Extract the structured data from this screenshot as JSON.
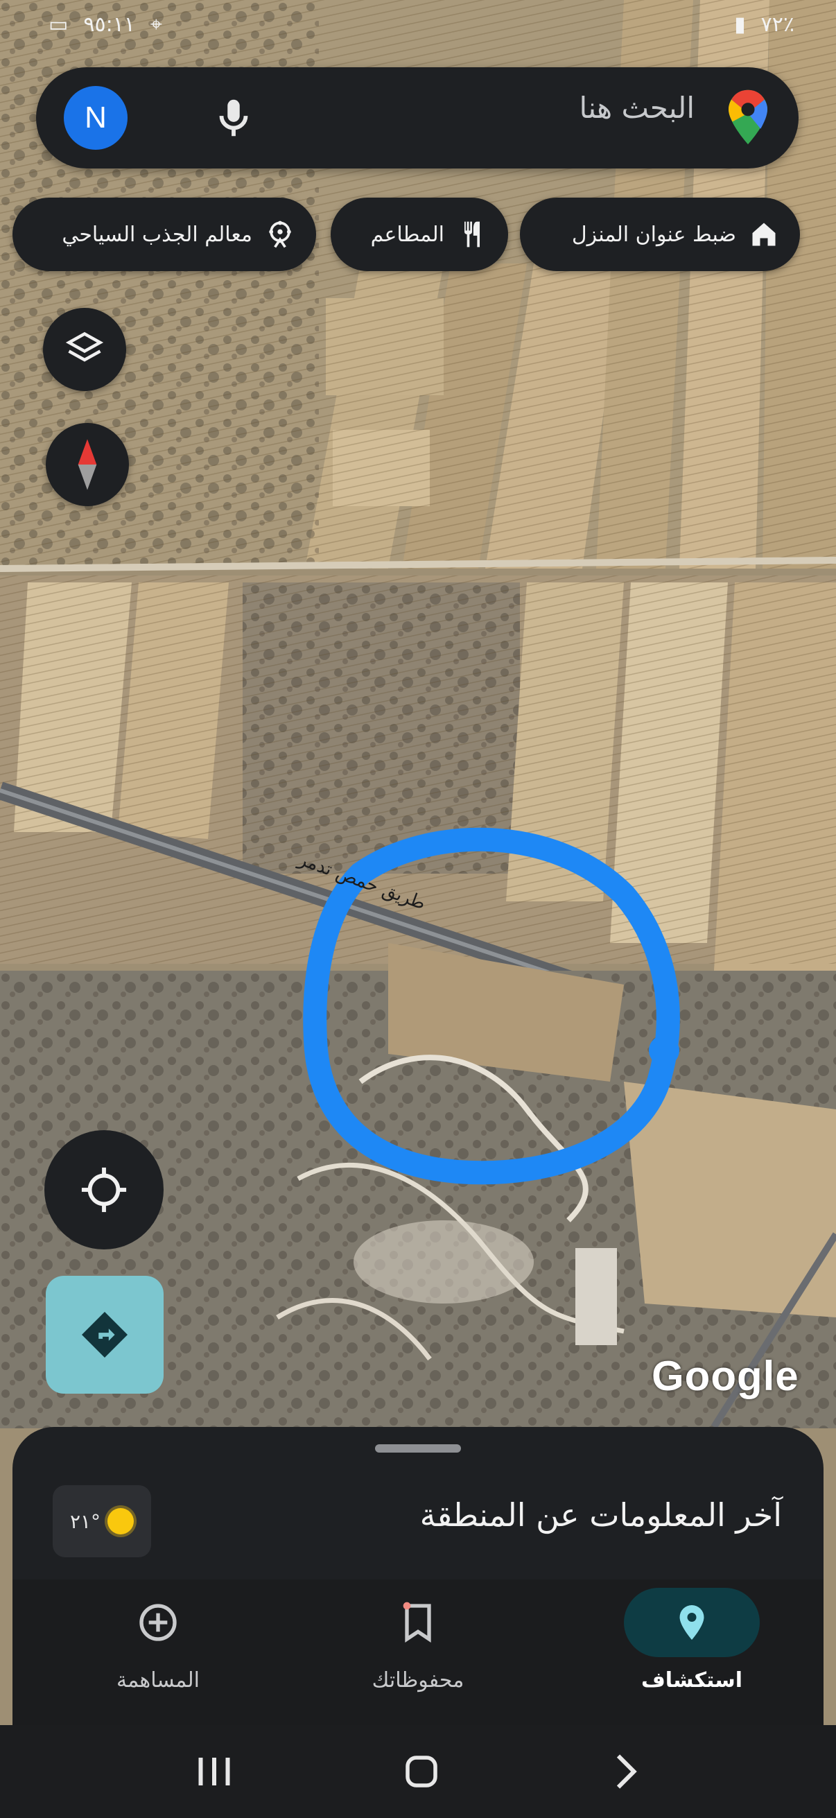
{
  "status_bar": {
    "time": "٩٥:١١",
    "battery": "٧٢٪"
  },
  "search": {
    "avatar_letter": "N",
    "placeholder": "البحث هنا"
  },
  "chips": [
    {
      "label": "ضبط عنوان المنزل",
      "icon": "home-icon"
    },
    {
      "label": "المطاعم",
      "icon": "fork-knife-icon"
    },
    {
      "label": "معالم الجذب السياحي",
      "icon": "ferris-wheel-icon"
    }
  ],
  "map": {
    "road_label": "طريق حمص تدمر",
    "attribution": "Google",
    "highlight_color": "#1e88f5"
  },
  "sheet": {
    "title": "آخر المعلومات عن المنطقة",
    "weather_temp": "٢١°"
  },
  "bottom_nav": {
    "explore": "استكشاف",
    "saved": "محفوظاتك",
    "contribute": "المساهمة"
  },
  "colors": {
    "accent": "#1a73e8",
    "nav_active_bg": "#0e3c44",
    "direction_button": "#7cc6cf"
  }
}
